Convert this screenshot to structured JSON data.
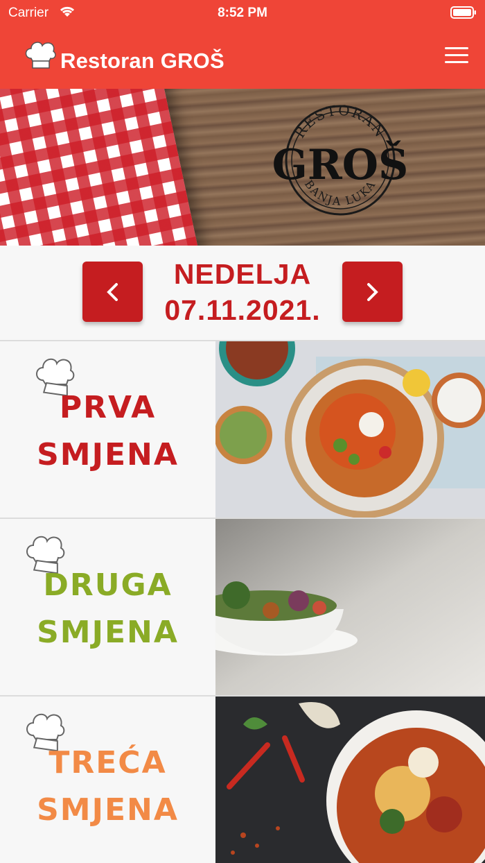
{
  "status_bar": {
    "carrier": "Carrier",
    "time": "8:52 PM"
  },
  "header": {
    "title": "Restoran GROŠ",
    "menu_icon": "hamburger-icon",
    "logo_icon": "chef-hat-icon"
  },
  "hero": {
    "logo_top": "RESTORAN",
    "logo_main": "GROŠ",
    "logo_bottom": "BANJA LUKA"
  },
  "day_nav": {
    "day": "NEDELJA",
    "date": "07.11.2021.",
    "prev_icon": "chevron-left-icon",
    "next_icon": "chevron-right-icon",
    "accent": "#c51d20"
  },
  "shifts": [
    {
      "line1": "PRVA",
      "line2": "SMJENA",
      "color": "#c51d20"
    },
    {
      "line1": "DRUGA",
      "line2": "SMJENA",
      "color": "#8aab26"
    },
    {
      "line1": "TREĆA",
      "line2": "SMJENA",
      "color": "#f28a46"
    }
  ],
  "colors": {
    "header": "#ef4537",
    "background": "#f7f7f7"
  }
}
